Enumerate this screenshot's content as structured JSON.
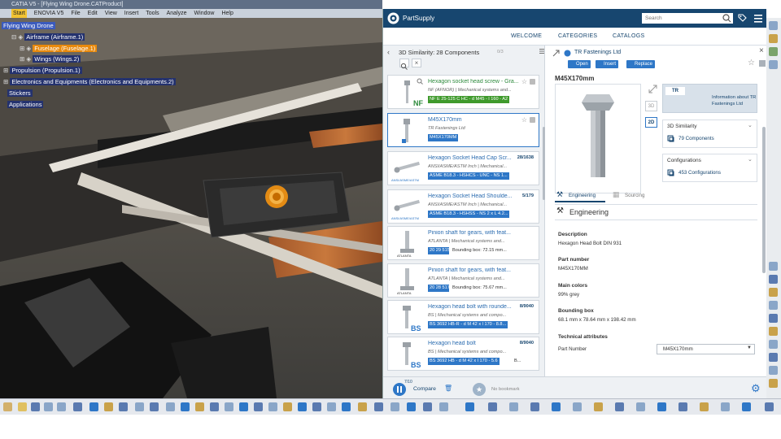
{
  "cad": {
    "title": "CATIA V5 - [Flying Wing Drone.CATProduct]",
    "menu": [
      "Start",
      "ENOVIA V5",
      "File",
      "Edit",
      "View",
      "Insert",
      "Tools",
      "Analyze",
      "Window",
      "Help"
    ],
    "tree": [
      {
        "label": "Flying Wing Drone",
        "style": "sel"
      },
      {
        "label": "Airframe (Airframe.1)",
        "style": "normal"
      },
      {
        "label": "Fuselage (Fuselage.1)",
        "style": "orange"
      },
      {
        "label": "Wings (Wings.2)",
        "style": "normal"
      },
      {
        "label": "Propulsion (Propulsion.1)",
        "style": "normal"
      },
      {
        "label": "Electronics and Equipments (Electronics and Equipments.2)",
        "style": "normal"
      },
      {
        "label": "Stickers",
        "style": "normal"
      },
      {
        "label": "Applications",
        "style": "normal"
      }
    ]
  },
  "ps": {
    "brand": "PartSupply",
    "search_placeholder": "Search",
    "nav": [
      "WELCOME",
      "CATEGORIES",
      "CATALOGS"
    ],
    "list_title": "3D Similarity: 28 Components",
    "list_title_extra": "0/3",
    "cards": [
      {
        "title": "Hexagon socket head screw - Gra...",
        "sub": "NF (AFNOR) | Mechanical systems and...",
        "tag": "NF E 25-125 C HC - d M45 - l 160 - A2",
        "extra": "",
        "count": "",
        "color": "green",
        "logo": "NF"
      },
      {
        "title": "M45X170mm",
        "sub": "TR Fastenings Ltd",
        "tag": "M45X170MM",
        "extra": "",
        "count": "",
        "color": "blue",
        "logo": ""
      },
      {
        "title": "Hexagon Socket Head Cap Scr...",
        "sub": "ANSI/ASME/ASTM Inch | Mechanical...",
        "tag": "ASME B18.3 - HSHCS - UNC - NS 1...",
        "extra": "",
        "count": "28/1638",
        "color": "blue",
        "logo": "ANSI/ASME/ASTM"
      },
      {
        "title": "Hexagon Socket Head Shoulde...",
        "sub": "ANSI/ASME/ASTM Inch | Mechanical...",
        "tag": "ASME B18.3 - HSHSS - NS 2 x L 4.2...",
        "extra": "",
        "count": "5/179",
        "color": "blue",
        "logo": "ANSI/ASME/ASTM"
      },
      {
        "title": "Pinion shaft for gears, with feat...",
        "sub": "ATLANTA | Mechanical systems and...",
        "tag": "20 29 515",
        "extra": "Bounding box: 72.15 mm...",
        "count": "",
        "color": "blue",
        "logo": "ATLANTA"
      },
      {
        "title": "Pinion shaft for gears, with feat...",
        "sub": "ATLANTA | Mechanical systems and...",
        "tag": "20 28 517",
        "extra": "Bounding box: 75.67 mm...",
        "count": "",
        "color": "blue",
        "logo": "ATLANTA"
      },
      {
        "title": "Hexagon head bolt with rounde...",
        "sub": "BS | Mechanical systems and compo...",
        "tag": "BS 3692 HB-R - d M 42 x l 170 - 8.8...",
        "extra": "",
        "count": "8/9040",
        "color": "blue",
        "logo": "BS"
      },
      {
        "title": "Hexagon head bolt",
        "sub": "BS | Mechanical systems and compo...",
        "tag": "BS 3692 HB - d M 42 x l 170 - 5.6",
        "extra": "B...",
        "count": "8/9040",
        "color": "blue",
        "logo": "BS"
      }
    ],
    "detail": {
      "supplier": "TR Fastenings Ltd",
      "buttons": [
        "Open",
        "Insert",
        "Replace"
      ],
      "part_title": "M45X170mm",
      "view_3d": "3D",
      "view_2d": "2D",
      "info_link": "Information about TR Fastenings Ltd",
      "similarity_title": "3D Similarity",
      "similarity_link": "79 Components",
      "config_title": "Configurations",
      "config_link": "453 Configurations",
      "tab_engineering": "Engineering",
      "tab_sourcing": "Sourcing",
      "section_title": "Engineering",
      "description_label": "Description",
      "description_value": "Hexagon Head Bolt DIN 931",
      "partnumber_label": "Part number",
      "partnumber_value": "M45X170MM",
      "colors_label": "Main colors",
      "colors_value": "99% grey",
      "bbox_label": "Bounding box",
      "bbox_value": "68.1 mm x 78.64 mm x 198.42 mm",
      "tech_label": "Technical attributes",
      "partnumber_field_label": "Part Number",
      "partnumber_field_value": "M45X170mm"
    },
    "footer": {
      "compare_count": "7/10",
      "compare_label": "Compare",
      "bookmark_label": "No bookmark"
    }
  },
  "colors": {
    "header": "#17466f",
    "accent": "#2e77c7",
    "green": "#3f9a2c",
    "selection": "#24326e"
  }
}
